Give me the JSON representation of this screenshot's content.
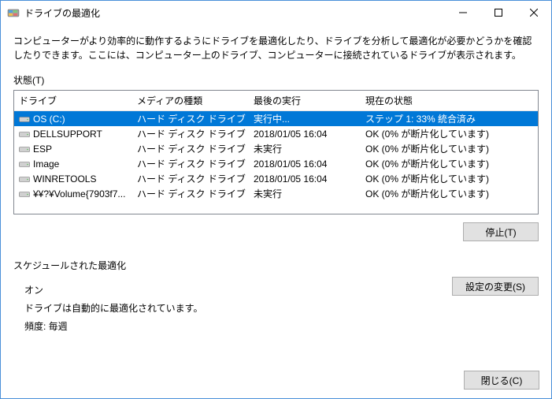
{
  "titlebar": {
    "title": "ドライブの最適化"
  },
  "description": "コンピューターがより効率的に動作するようにドライブを最適化したり、ドライブを分析して最適化が必要かどうかを確認したりできます。ここには、コンピューター上のドライブ、コンピューターに接続されているドライブが表示されます。",
  "status_section_label": "状態(T)",
  "columns": {
    "drive": "ドライブ",
    "media": "メディアの種類",
    "last_run": "最後の実行",
    "current_state": "現在の状態"
  },
  "rows": [
    {
      "drive": "OS (C:)",
      "media": "ハード ディスク ドライブ",
      "last": "実行中...",
      "state": "ステップ 1: 33% 統合済み",
      "selected": true
    },
    {
      "drive": "DELLSUPPORT",
      "media": "ハード ディスク ドライブ",
      "last": "2018/01/05 16:04",
      "state": "OK (0% が断片化しています)",
      "selected": false
    },
    {
      "drive": "ESP",
      "media": "ハード ディスク ドライブ",
      "last": "未実行",
      "state": "OK (0% が断片化しています)",
      "selected": false
    },
    {
      "drive": "Image",
      "media": "ハード ディスク ドライブ",
      "last": "2018/01/05 16:04",
      "state": "OK (0% が断片化しています)",
      "selected": false
    },
    {
      "drive": "WINRETOOLS",
      "media": "ハード ディスク ドライブ",
      "last": "2018/01/05 16:04",
      "state": "OK (0% が断片化しています)",
      "selected": false
    },
    {
      "drive": "¥¥?¥Volume{7903f7...",
      "media": "ハード ディスク ドライブ",
      "last": "未実行",
      "state": "OK (0% が断片化しています)",
      "selected": false
    }
  ],
  "buttons": {
    "stop": "停止(T)",
    "change_settings": "設定の変更(S)",
    "close": "閉じる(C)"
  },
  "schedule": {
    "section_label": "スケジュールされた最適化",
    "on_label": "オン",
    "auto_text": "ドライブは自動的に最適化されています。",
    "frequency_label": "頻度: 毎週"
  }
}
